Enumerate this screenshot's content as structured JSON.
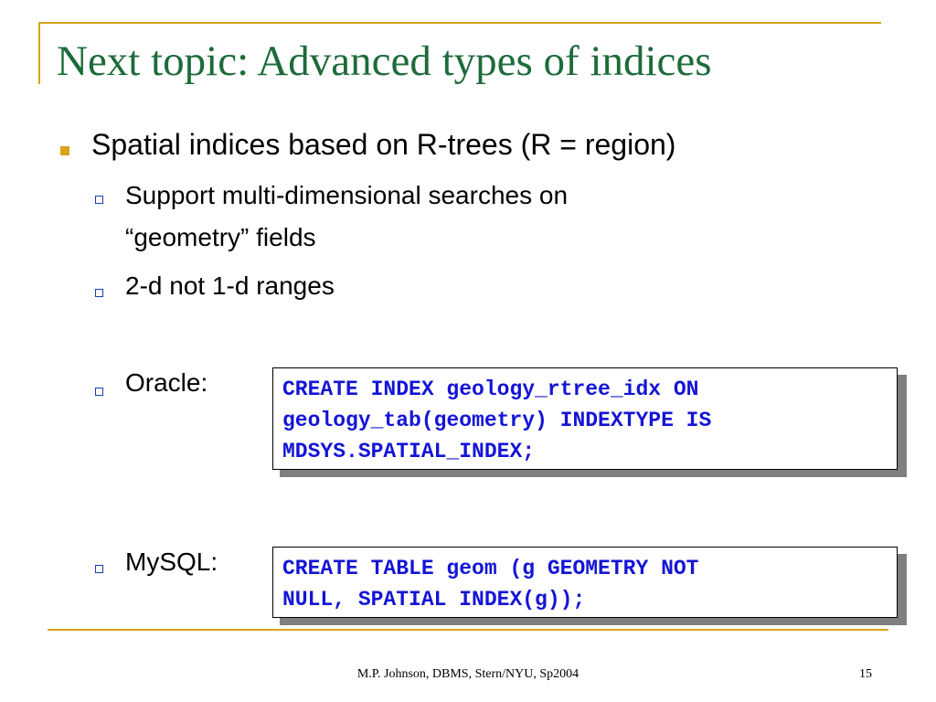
{
  "slide": {
    "title": "Next topic: Advanced types of indices",
    "bullet_main": "Spatial indices based on R-trees (R = region)",
    "sub_bullets": [
      "Support multi-dimensional searches on",
      "“geometry” fields",
      "2-d not 1-d ranges",
      "Oracle:",
      "MySQL:"
    ],
    "code_oracle": [
      "CREATE INDEX geology_rtree_idx ON",
      "geology_tab(geometry) INDEXTYPE IS",
      "MDSYS.SPATIAL_INDEX;"
    ],
    "code_mysql": [
      "CREATE TABLE geom (g GEOMETRY NOT",
      "NULL, SPATIAL INDEX(g));"
    ],
    "footer": "M.P. Johnson, DBMS, Stern/NYU, Sp2004",
    "page_number": "15"
  },
  "colors": {
    "title": "#1d6b3a",
    "accent": "#d9a31a",
    "code": "#1414d6",
    "sub_bullet": "#1a3fb8"
  }
}
